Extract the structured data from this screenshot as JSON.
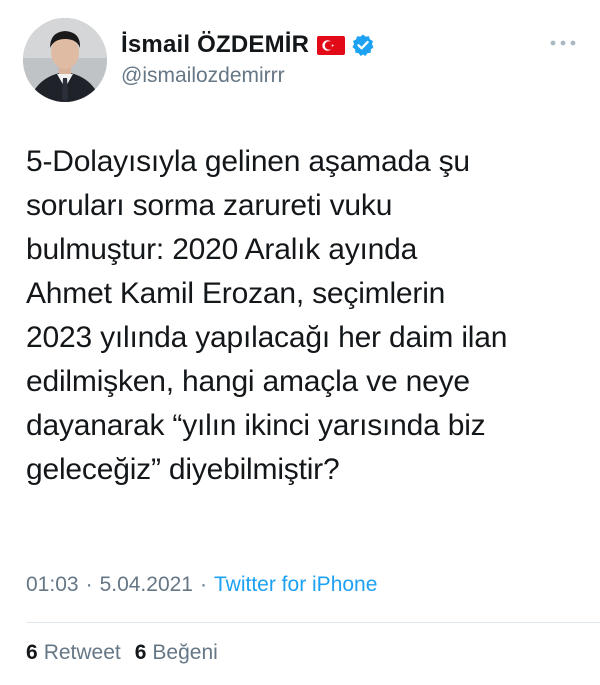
{
  "author": {
    "display_name": "İsmail ÖZDEMİR",
    "handle": "@ismailozdemirrr",
    "flag_icon": "turkey-flag-icon",
    "verified_icon": "verified-badge-icon",
    "verified_color": "#1da1f2"
  },
  "tweet": {
    "text": "5-Dolayısıyla gelinen aşamada şu\nsoruları sorma zarureti vuku\nbulmuştur: 2020 Aralık ayında\nAhmet Kamil Erozan, seçimlerin\n2023 yılında yapılacağı her daim ilan\nedilmişken, hangi amaçla ve neye\ndayanarak “yılın ikinci yarısında biz\ngeleceğiz” diyebilmiştir?",
    "time": "01:03",
    "date": "5.04.2021",
    "separator": "·",
    "source": "Twitter for iPhone"
  },
  "stats": {
    "retweet_count": "6",
    "retweet_label": "Retweet",
    "like_count": "6",
    "like_label": "Beğeni"
  },
  "icons": {
    "more": "more-options-icon"
  },
  "colors": {
    "text_primary": "#14171a",
    "text_secondary": "#657786",
    "link": "#1da1f2",
    "flag_red": "#e30a17"
  }
}
